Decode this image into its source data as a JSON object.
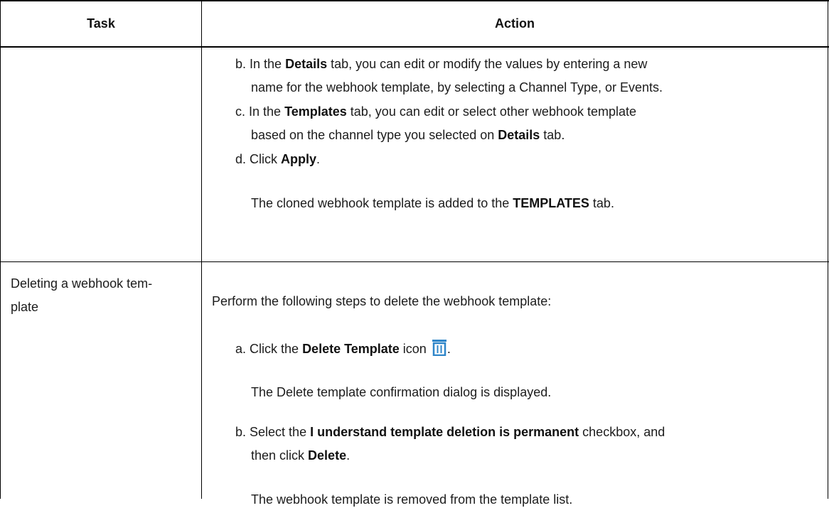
{
  "table": {
    "headers": {
      "task": "Task",
      "action": "Action"
    },
    "row1": {
      "step_b": {
        "marker": "b.",
        "pre": "In the ",
        "bold": "Details",
        "post": " tab, you can edit or modify the values by entering a new",
        "cont": "name for the webhook template, by selecting a Channel Type, or Events."
      },
      "step_c": {
        "marker": "c.",
        "pre": "In the ",
        "bold": "Templates",
        "post": " tab, you can edit or select other webhook template",
        "cont_pre": "based on the channel type you selected on ",
        "cont_bold": "Details",
        "cont_post": " tab."
      },
      "step_d": {
        "marker": "d.",
        "pre": "Click ",
        "bold": "Apply",
        "post": "."
      },
      "result": {
        "pre": "The cloned webhook template is added to the ",
        "bold": "TEMPLATES",
        "post": " tab."
      }
    },
    "row2": {
      "task_line1": "Deleting a webhook tem-",
      "task_line2": "plate",
      "intro": "Perform the following steps to delete the webhook template:",
      "step_a": {
        "marker": "a.",
        "pre": "Click the ",
        "bold": "Delete Template",
        "post": " icon ",
        "end": "."
      },
      "step_a_result": "The Delete template confirmation dialog is displayed.",
      "step_b": {
        "marker": "b.",
        "pre": "Select the ",
        "bold": "I understand template deletion is permanent",
        "post": " checkbox, and",
        "cont_pre": "then click ",
        "cont_bold": "Delete",
        "cont_post": "."
      },
      "step_b_result": "The webhook template is removed from the template list."
    }
  },
  "colors": {
    "border": "#000000",
    "text": "#1c1c1c",
    "icon": "#2f86c9"
  },
  "icons": {
    "delete_template": "trash-icon"
  }
}
